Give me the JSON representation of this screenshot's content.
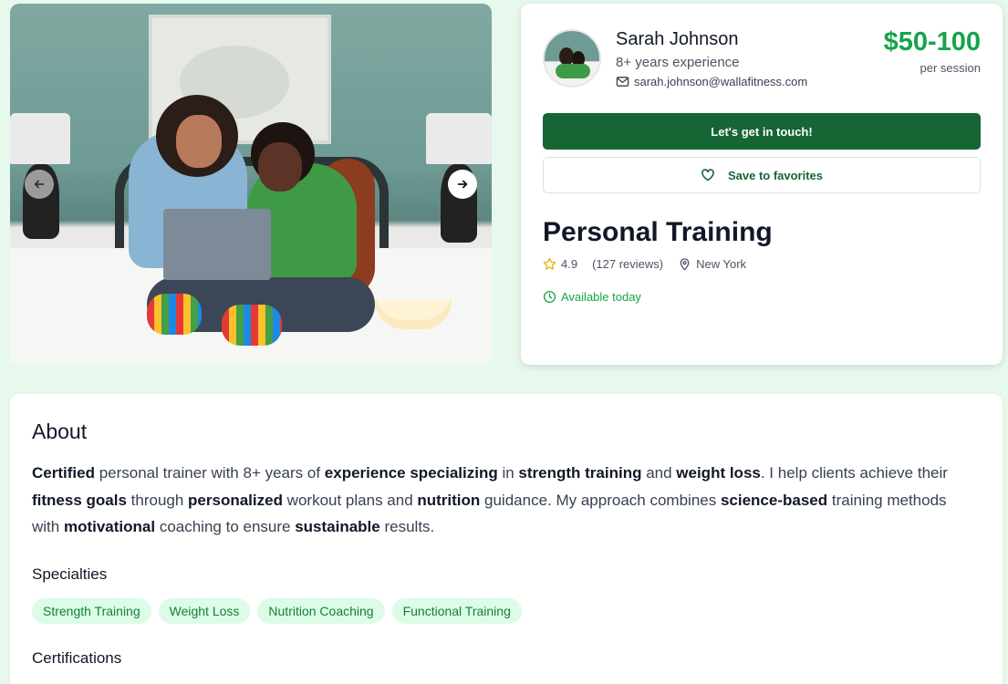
{
  "gallery": {
    "photo": "two-women-laptop-bed-photo",
    "prev_icon": "arrow-left-icon",
    "next_icon": "arrow-right-icon"
  },
  "profile": {
    "name": "Sarah Johnson",
    "experience": "8+ years experience",
    "email": "sarah.johnson@wallafitness.com",
    "price": "$50-100",
    "price_unit": "per session",
    "cta_label": "Let's get in touch!",
    "favorite_label": "Save to favorites",
    "service_title": "Personal Training",
    "rating": "4.9",
    "reviews": "(127 reviews)",
    "location": "New York",
    "availability": "Available today"
  },
  "about": {
    "heading": "About",
    "bio": [
      {
        "t": "Certified",
        "b": true
      },
      {
        "t": " personal trainer with 8+ years of ",
        "b": false
      },
      {
        "t": "experience specializing",
        "b": true
      },
      {
        "t": " in ",
        "b": false
      },
      {
        "t": "strength training",
        "b": true
      },
      {
        "t": " and ",
        "b": false
      },
      {
        "t": "weight loss",
        "b": true
      },
      {
        "t": ". I help clients achieve their ",
        "b": false
      },
      {
        "t": "fitness goals",
        "b": true
      },
      {
        "t": " through ",
        "b": false
      },
      {
        "t": "personalized",
        "b": true
      },
      {
        "t": " workout plans and ",
        "b": false
      },
      {
        "t": "nutrition",
        "b": true
      },
      {
        "t": " guidance. My approach combines ",
        "b": false
      },
      {
        "t": "science-based",
        "b": true
      },
      {
        "t": " training methods with ",
        "b": false
      },
      {
        "t": "motivational",
        "b": true
      },
      {
        "t": " coaching to ensure ",
        "b": false
      },
      {
        "t": "sustainable",
        "b": true
      },
      {
        "t": " results.",
        "b": false
      }
    ],
    "specialties_heading": "Specialties",
    "specialties": [
      "Strength Training",
      "Weight Loss",
      "Nutrition Coaching",
      "Functional Training"
    ],
    "certifications_heading": "Certifications"
  },
  "colors": {
    "accent": "#16a34a",
    "cta_background": "#166534",
    "tag_background": "#dcfce7",
    "page_background": "#e6f9ec"
  }
}
